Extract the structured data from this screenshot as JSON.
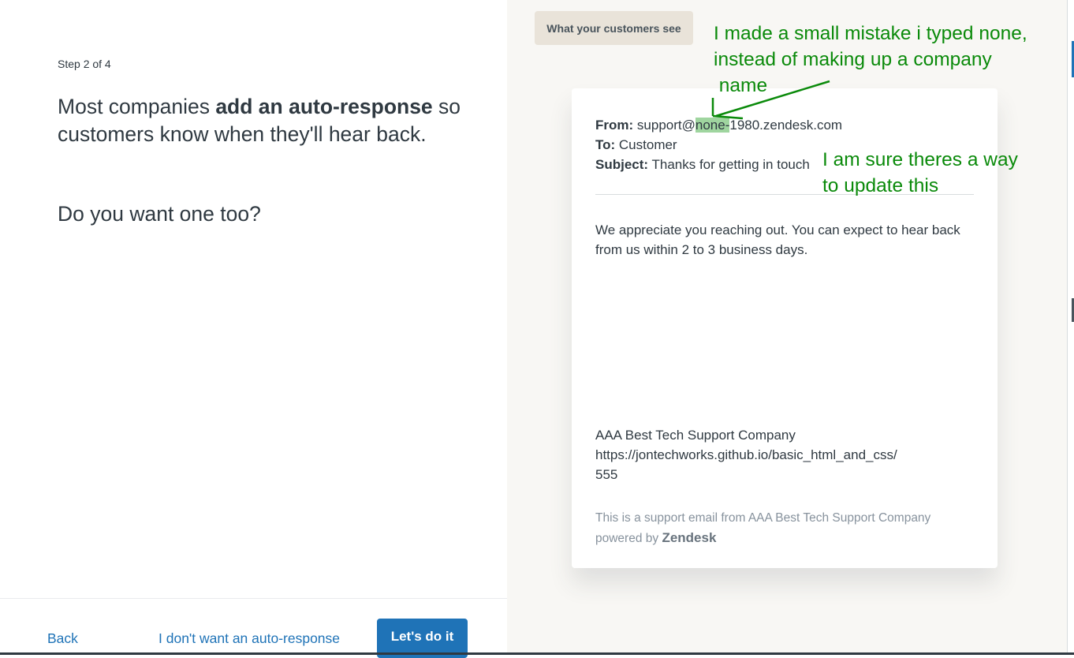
{
  "wizard": {
    "step": "Step 2 of 4",
    "headline_pre": "Most companies ",
    "headline_bold": "add an auto-response",
    "headline_post": " so customers know when they'll hear back.",
    "question": "Do you want one too?"
  },
  "footer": {
    "back": "Back",
    "decline": "I don't want an auto-response",
    "confirm": "Let's do it"
  },
  "preview": {
    "tab_label": "What your customers see",
    "email": {
      "from_label": "From:",
      "from_prefix": "support@",
      "from_highlight": "none-",
      "from_suffix": "1980.zendesk.com",
      "to_label": "To:",
      "to_value": "Customer",
      "subject_label": "Subject:",
      "subject_value": "Thanks for getting in touch",
      "body": "We appreciate you reaching out. You can expect to hear back from us within 2 to 3 business days.",
      "signature_company": "AAA Best Tech Support Company",
      "signature_url": "https://jontechworks.github.io/basic_html_and_css/",
      "signature_phone": "555",
      "footer_note": "This is a support email from AAA Best Tech Support Company powered by",
      "footer_brand": "Zendesk"
    }
  },
  "annotations": {
    "note1_line1": "I made a small mistake i typed none,",
    "note1_line2": "instead of making up a company",
    "note1_line3": " name",
    "note2_line1": "I am sure theres a way",
    "note2_line2": "to update this",
    "color": "#0a8a0a"
  },
  "colors": {
    "primary": "#1f73b7",
    "text": "#2f3941",
    "preview_bg": "#f8f7f4",
    "tab_bg": "#e9e3d9",
    "highlight": "#9fd59f"
  }
}
